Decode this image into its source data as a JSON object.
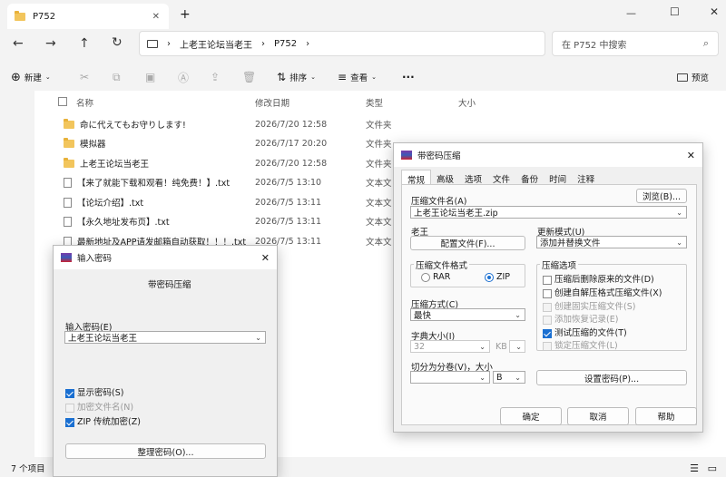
{
  "window": {
    "tab_title": "P752",
    "new_tab": "+",
    "controls": [
      "—",
      "☐",
      "✕"
    ]
  },
  "address": {
    "crumbs": [
      "上老王论坛当老王",
      "P752"
    ],
    "search_placeholder": "在 P752 中搜索"
  },
  "commands": {
    "new": "新建",
    "sort": "排序",
    "view": "查看",
    "more": "···",
    "preview": "预览"
  },
  "columns": {
    "name": "名称",
    "date": "修改日期",
    "type": "类型",
    "size": "大小"
  },
  "files": [
    {
      "name": "命に代えてもお守りします!",
      "date": "2026/7/20 12:58",
      "type": "文件夹",
      "icon": "folder"
    },
    {
      "name": "模拟器",
      "date": "2026/7/17 20:20",
      "type": "文件夹",
      "icon": "folder"
    },
    {
      "name": "上老王论坛当老王",
      "date": "2026/7/20 12:58",
      "type": "文件夹",
      "icon": "folder"
    },
    {
      "name": "【来了就能下载和观看！纯免费！】.txt",
      "date": "2026/7/5 13:10",
      "type": "文本文",
      "icon": "txt"
    },
    {
      "name": "【论坛介绍】.txt",
      "date": "2026/7/5 13:11",
      "type": "文本文",
      "icon": "txt"
    },
    {
      "name": "【永久地址发布页】.txt",
      "date": "2026/7/5 13:11",
      "type": "文本文",
      "icon": "txt"
    },
    {
      "name": "最新地址及APP请发邮箱自动获取！！！.txt",
      "date": "2026/7/5 13:11",
      "type": "文本文",
      "icon": "txt"
    }
  ],
  "status": {
    "count": "7 个项目"
  },
  "pwd": {
    "title": "输入密码",
    "heading": "带密码压缩",
    "label": "输入密码(E)",
    "value": "上老王论坛当老王",
    "show": "显示密码(S)",
    "encrypt_names": "加密文件名(N)",
    "zip_legacy": "ZIP 传统加密(Z)",
    "organize": "整理密码(O)..."
  },
  "arc": {
    "title": "带密码压缩",
    "tabs": [
      "常规",
      "高级",
      "选项",
      "文件",
      "备份",
      "时间",
      "注释"
    ],
    "archive_name_label": "压缩文件名(A)",
    "browse": "浏览(B)...",
    "archive_name": "上老王论坛当老王.zip",
    "profile_label": "老王",
    "profiles_btn": "配置文件(F)...",
    "update_label": "更新模式(U)",
    "update_value": "添加并替换文件",
    "format_group": "压缩文件格式",
    "rar": "RAR",
    "zip": "ZIP",
    "method_label": "压缩方式(C)",
    "method_value": "最快",
    "dict_label": "字典大小(I)",
    "dict_value": "32",
    "dict_unit": "KB",
    "split_label": "切分为分卷(V)，大小",
    "split_unit": "B",
    "options_group": "压缩选项",
    "opt1": "压缩后删除原来的文件(D)",
    "opt2": "创建自解压格式压缩文件(X)",
    "opt3": "创建固实压缩文件(S)",
    "opt4": "添加恢复记录(E)",
    "opt5": "测试压缩的文件(T)",
    "opt6": "锁定压缩文件(L)",
    "set_password": "设置密码(P)...",
    "ok": "确定",
    "cancel": "取消",
    "help": "帮助"
  }
}
